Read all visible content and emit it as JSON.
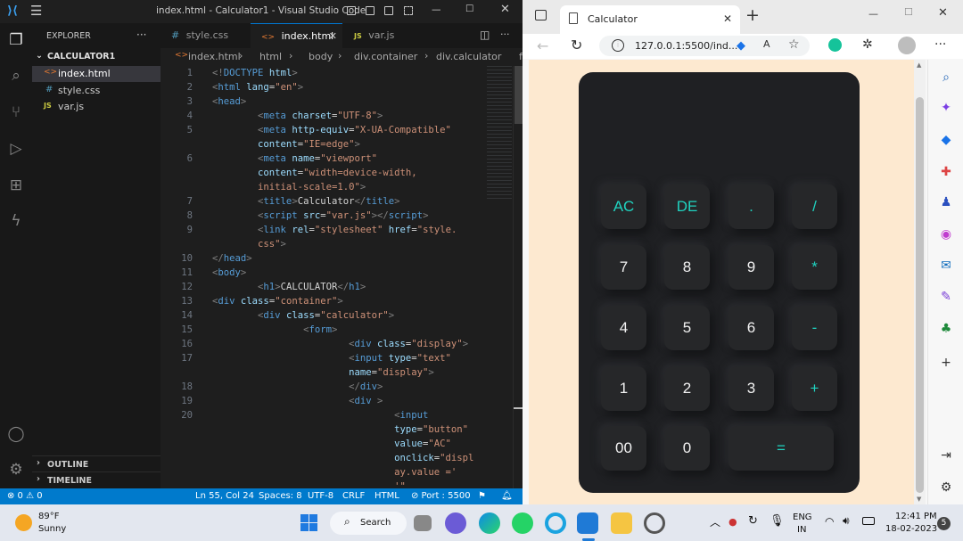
{
  "vscode": {
    "title": "index.html - Calculator1 - Visual Studio Code",
    "explorer_label": "EXPLORER",
    "explorer_more": "···",
    "project": "CALCULATOR1",
    "files": [
      {
        "icon": "<>",
        "name": "index.html"
      },
      {
        "icon": "#",
        "name": "style.css"
      },
      {
        "icon": "JS",
        "name": "var.js"
      }
    ],
    "outline": "OUTLINE",
    "timeline": "TIMELINE",
    "tabs": [
      {
        "icon": "#",
        "label": "style.css"
      },
      {
        "icon": "<>",
        "label": "index.html"
      },
      {
        "icon": "JS",
        "label": "var.js"
      }
    ],
    "breadcrumb": [
      "index.html",
      "html",
      "body",
      "div.container",
      "div.calculator",
      "f"
    ],
    "code_lines": [
      {
        "n": "1",
        "html": "<span class='br'>&lt;!</span><span class='tg'>DOCTYPE</span> <span class='at'>html</span><span class='br'>&gt;</span>"
      },
      {
        "n": "2",
        "html": "<span class='br'>&lt;</span><span class='tg'>html</span> <span class='at'>lang</span>=<span class='st'>\"en\"</span><span class='br'>&gt;</span>"
      },
      {
        "n": "3",
        "html": "<span class='br'>&lt;</span><span class='tg'>head</span><span class='br'>&gt;</span>"
      },
      {
        "n": "4",
        "html": "        <span class='br'>&lt;</span><span class='tg'>meta</span> <span class='at'>charset</span>=<span class='st'>\"UTF-8\"</span><span class='br'>&gt;</span>"
      },
      {
        "n": "5",
        "html": "        <span class='br'>&lt;</span><span class='tg'>meta</span> <span class='at'>http-equiv</span>=<span class='st'>\"X-UA-Compatible\"</span>"
      },
      {
        "n": "",
        "html": "        <span class='at'>content</span>=<span class='st'>\"IE=edge\"</span><span class='br'>&gt;</span>"
      },
      {
        "n": "6",
        "html": "        <span class='br'>&lt;</span><span class='tg'>meta</span> <span class='at'>name</span>=<span class='st'>\"viewport\"</span>"
      },
      {
        "n": "",
        "html": "        <span class='at'>content</span>=<span class='st'>\"width=device-width,</span>"
      },
      {
        "n": "",
        "html": "        <span class='st'>initial-scale=1.0\"</span><span class='br'>&gt;</span>"
      },
      {
        "n": "7",
        "html": "        <span class='br'>&lt;</span><span class='tg'>title</span><span class='br'>&gt;</span>Calculator<span class='br'>&lt;/</span><span class='tg'>title</span><span class='br'>&gt;</span>"
      },
      {
        "n": "8",
        "html": "        <span class='br'>&lt;</span><span class='tg'>script</span> <span class='at'>src</span>=<span class='st'>\"var.js\"</span><span class='br'>&gt;&lt;/</span><span class='tg'>script</span><span class='br'>&gt;</span>"
      },
      {
        "n": "9",
        "html": "        <span class='br'>&lt;</span><span class='tg'>link</span> <span class='at'>rel</span>=<span class='st'>\"stylesheet\"</span> <span class='at'>href</span>=<span class='st'>\"style.</span>"
      },
      {
        "n": "",
        "html": "        <span class='st'>css\"</span><span class='br'>&gt;</span>"
      },
      {
        "n": "10",
        "html": "<span class='br'>&lt;/</span><span class='tg'>head</span><span class='br'>&gt;</span>"
      },
      {
        "n": "11",
        "html": "<span class='br'>&lt;</span><span class='tg'>body</span><span class='br'>&gt;</span>"
      },
      {
        "n": "12",
        "html": "        <span class='br'>&lt;</span><span class='tg'>h1</span><span class='br'>&gt;</span>CALCULATOR<span class='br'>&lt;/</span><span class='tg'>h1</span><span class='br'>&gt;</span>"
      },
      {
        "n": "13",
        "html": "<span class='br'>&lt;</span><span class='tg'>div</span> <span class='at'>class</span>=<span class='st'>\"container\"</span><span class='br'>&gt;</span>"
      },
      {
        "n": "14",
        "html": "        <span class='br'>&lt;</span><span class='tg'>div</span> <span class='at'>class</span>=<span class='st'>\"calculator\"</span><span class='br'>&gt;</span>"
      },
      {
        "n": "15",
        "html": "                <span class='br'>&lt;</span><span class='tg'>form</span><span class='br'>&gt;</span>"
      },
      {
        "n": "16",
        "html": "                        <span class='br'>&lt;</span><span class='tg'>div</span> <span class='at'>class</span>=<span class='st'>\"display\"</span><span class='br'>&gt;</span>"
      },
      {
        "n": "17",
        "html": "                        <span class='br'>&lt;</span><span class='tg'>input</span> <span class='at'>type</span>=<span class='st'>\"text\"</span>"
      },
      {
        "n": "",
        "html": "                        <span class='at'>name</span>=<span class='st'>\"display\"</span><span class='br'>&gt;</span>"
      },
      {
        "n": "18",
        "html": "                        <span class='br'>&lt;/</span><span class='tg'>div</span><span class='br'>&gt;</span>"
      },
      {
        "n": "19",
        "html": "                        <span class='br'>&lt;</span><span class='tg'>div</span> <span class='br'>&gt;</span>"
      },
      {
        "n": "20",
        "html": "                                <span class='br'>&lt;</span><span class='tg'>input</span>"
      },
      {
        "n": "",
        "html": "                                <span class='at'>type</span>=<span class='st'>\"button\"</span>"
      },
      {
        "n": "",
        "html": "                                <span class='at'>value</span>=<span class='st'>\"AC\"</span>"
      },
      {
        "n": "",
        "html": "                                <span class='at'>onclick</span>=<span class='st'>\"displ</span>"
      },
      {
        "n": "",
        "html": "                                <span class='st'>ay.value ='</span>"
      },
      {
        "n": "",
        "html": "                                <span class='st'>'\"</span>"
      }
    ],
    "status": {
      "problems": "⊗ 0 ⚠ 0",
      "position": "Ln 55, Col 24",
      "spaces": "Spaces: 8",
      "encoding": "UTF-8",
      "eol": "CRLF",
      "language": "HTML",
      "port": "⊘ Port : 5500"
    }
  },
  "browser": {
    "tab_title": "Calculator",
    "url": "127.0.0.1:5500/ind...",
    "calculator_keys": [
      {
        "label": "AC",
        "accent": true
      },
      {
        "label": "DE",
        "accent": true
      },
      {
        "label": ".",
        "accent": true
      },
      {
        "label": "/",
        "accent": true
      },
      {
        "label": "7",
        "accent": false
      },
      {
        "label": "8",
        "accent": false
      },
      {
        "label": "9",
        "accent": false
      },
      {
        "label": "*",
        "accent": true
      },
      {
        "label": "4",
        "accent": false
      },
      {
        "label": "5",
        "accent": false
      },
      {
        "label": "6",
        "accent": false
      },
      {
        "label": "-",
        "accent": true
      },
      {
        "label": "1",
        "accent": false
      },
      {
        "label": "2",
        "accent": false
      },
      {
        "label": "3",
        "accent": false
      },
      {
        "label": "+",
        "accent": true
      },
      {
        "label": "00",
        "accent": false
      },
      {
        "label": "0",
        "accent": false
      },
      {
        "label": "=",
        "accent": true
      }
    ],
    "colors": {
      "accent": "#20d3c0",
      "page_bg": "#fde9d0",
      "calc_bg": "#1f2023"
    }
  },
  "taskbar": {
    "weather_temp": "89°F",
    "weather_desc": "Sunny",
    "search_label": "Search",
    "lang_line1": "ENG",
    "lang_line2": "IN",
    "time": "12:41 PM",
    "date": "18-02-2023",
    "notif_count": "5"
  }
}
